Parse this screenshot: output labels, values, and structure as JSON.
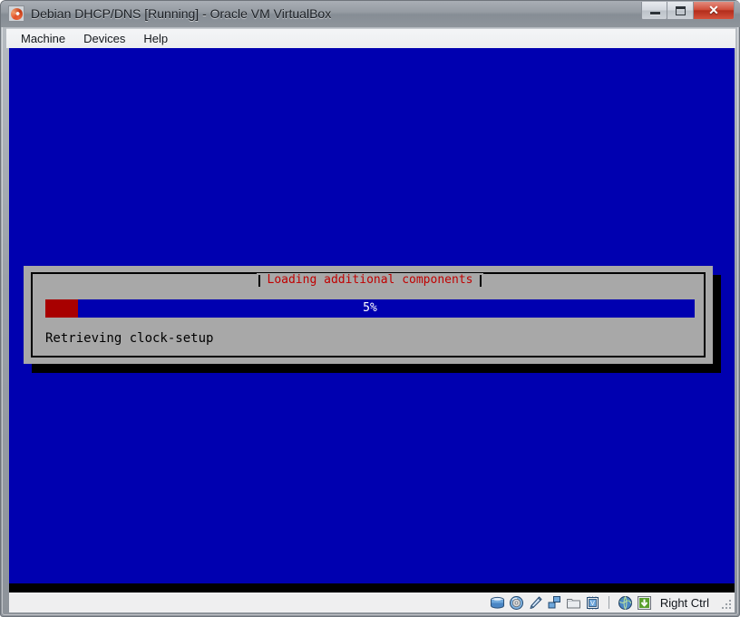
{
  "window": {
    "title": "Debian DHCP/DNS [Running] - Oracle VM VirtualBox",
    "app_icon": "virtualbox-icon",
    "controls": {
      "minimize_label": "–",
      "maximize_label": "□",
      "close_label": "✕"
    }
  },
  "menubar": {
    "items": [
      {
        "label": "Machine",
        "name": "menu-machine"
      },
      {
        "label": "Devices",
        "name": "menu-devices"
      },
      {
        "label": "Help",
        "name": "menu-help"
      }
    ]
  },
  "vm_screen": {
    "background_color": "#0000b0",
    "dialog": {
      "title": "Loading additional components",
      "title_color": "#c00000",
      "background_color": "#a8a8a8",
      "progress": {
        "percent": 5,
        "label": "5%",
        "fill_color": "#a80000",
        "track_color": "#0000b0"
      },
      "status_text": "Retrieving clock-setup"
    }
  },
  "statusbar": {
    "icons": [
      {
        "name": "hard-disk-icon",
        "title": "hard disks"
      },
      {
        "name": "optical-disk-icon",
        "title": "optical drives"
      },
      {
        "name": "floppy-disk-icon",
        "title": "floppy drives"
      },
      {
        "name": "network-icon",
        "title": "network adapters"
      },
      {
        "name": "shared-folders-icon",
        "title": "shared folders"
      },
      {
        "name": "display-icon",
        "title": "display"
      }
    ],
    "right_icons": [
      {
        "name": "remote-desktop-icon",
        "title": "remote desktop"
      },
      {
        "name": "capture-icon",
        "title": "video capture"
      }
    ],
    "host_key": "Right Ctrl"
  }
}
